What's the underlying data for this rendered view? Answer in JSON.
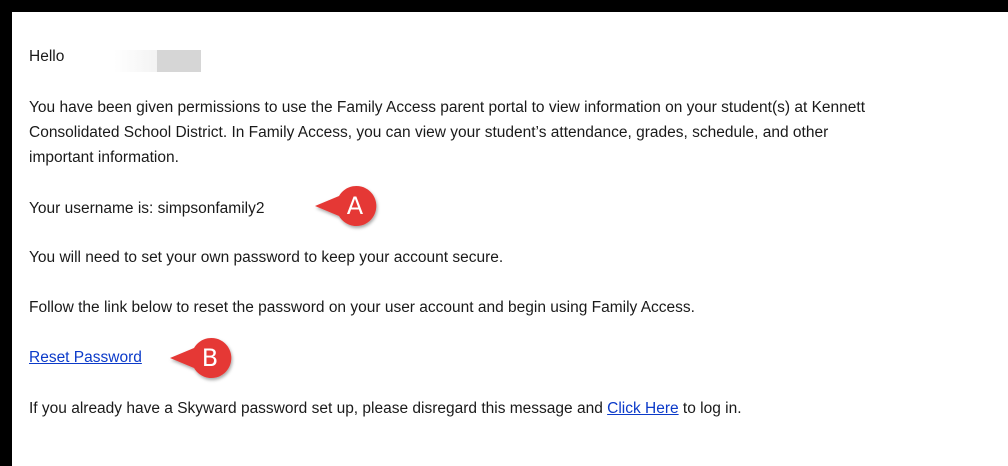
{
  "email": {
    "greeting": "Hello",
    "intro_line1": "You have been given permissions to use the Family Access parent portal to view information on your student(s) at Kennett",
    "intro_line2": "Consolidated School District. In Family Access, you can view your student’s attendance, grades, schedule, and other",
    "intro_line3": "important information.",
    "username_line": "Your username is: simpsonfamily2",
    "password_notice": "You will need to set your own password to keep your account secure.",
    "follow_link_text": "Follow the link below to reset the password on your user account and begin using Family Access.",
    "reset_link_label": "Reset Password",
    "disregard_prefix": "If you already have a Skyward password set up, please disregard this message and ",
    "click_here_label": "Click Here",
    "disregard_suffix": " to log in."
  },
  "callouts": {
    "a_label": "A",
    "b_label": "B",
    "color": "#e53935"
  },
  "colors": {
    "link": "#0b3ac9",
    "frame": "#000000",
    "redaction": "#d6d6d6"
  }
}
